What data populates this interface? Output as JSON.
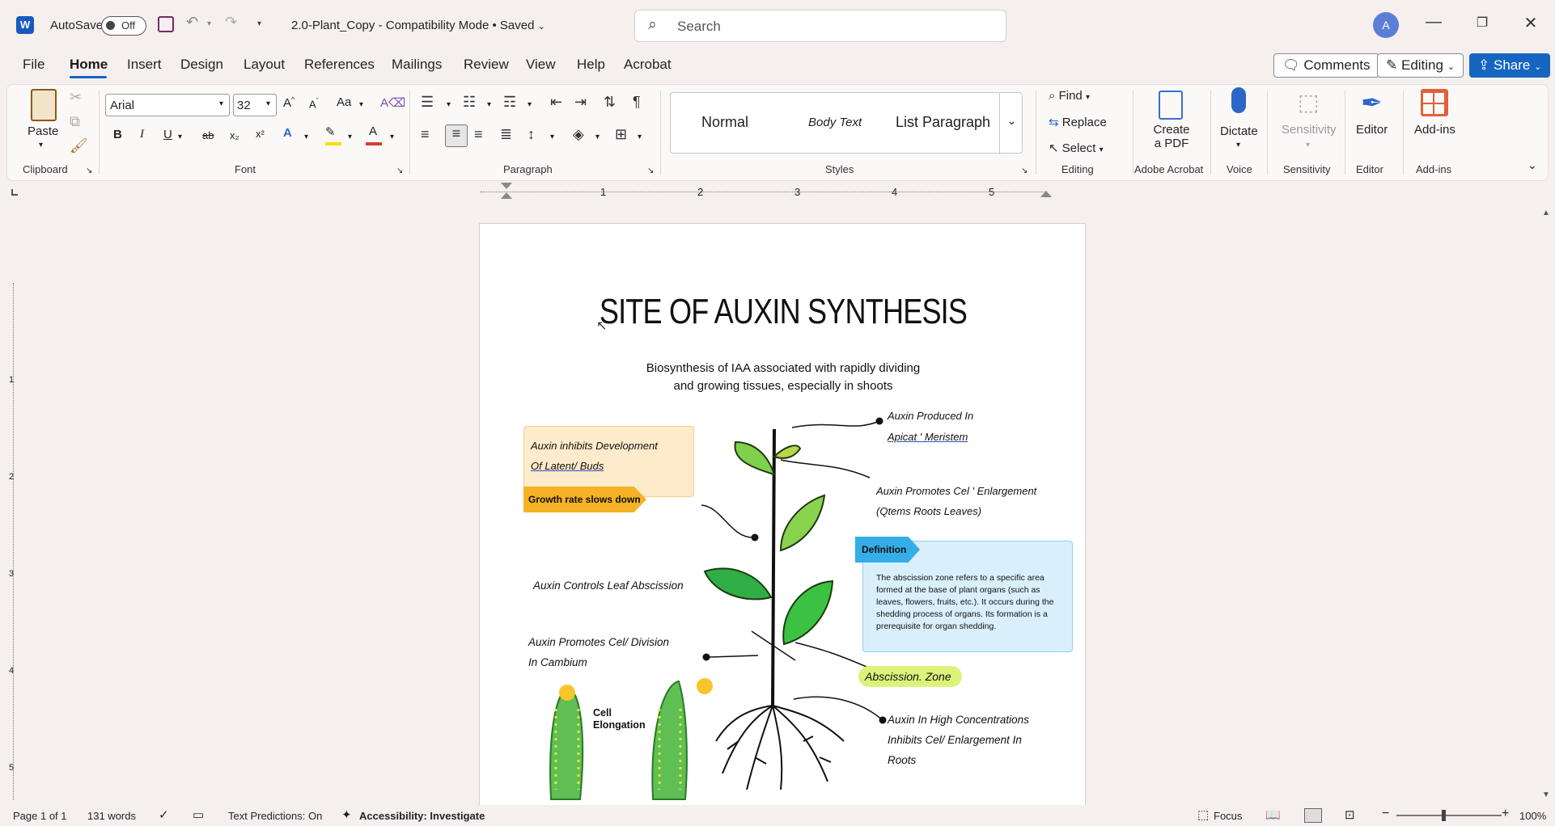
{
  "titlebar": {
    "autosave_label": "AutoSave",
    "autosave_state": "Off",
    "doc_name": "2.0-Plant_Copy",
    "doc_mode": "Compatibility Mode",
    "doc_status": "Saved",
    "search_placeholder": "Search",
    "avatar_initial": "A"
  },
  "menu": {
    "items": [
      "File",
      "Home",
      "Insert",
      "Design",
      "Layout",
      "References",
      "Mailings",
      "Review",
      "View",
      "Help",
      "Acrobat"
    ],
    "active": "Home",
    "comments_label": "Comments",
    "editing_label": "Editing",
    "share_label": "Share"
  },
  "ribbon": {
    "paste_label": "Paste",
    "font_name": "Arial",
    "font_size": "32",
    "case_label": "Aa",
    "bold": "B",
    "italic": "I",
    "underline": "U",
    "strike": "ab",
    "subscript": "x₂",
    "superscript": "x²",
    "styles": [
      "Normal",
      "Body Text",
      "List Paragraph"
    ],
    "find_label": "Find",
    "replace_label": "Replace",
    "select_label": "Select",
    "create_pdf_label_1": "Create",
    "create_pdf_label_2": "a PDF",
    "dictate_label": "Dictate",
    "sensitivity_label": "Sensitivity",
    "editor_label": "Editor",
    "addins_label": "Add-ins",
    "groups": {
      "clipboard": "Clipboard",
      "font": "Font",
      "paragraph": "Paragraph",
      "styles": "Styles",
      "editing": "Editing",
      "adobe": "Adobe Acrobat",
      "voice": "Voice",
      "sensitivity": "Sensitivity",
      "editor": "Editor",
      "addins": "Add-ins"
    },
    "accent_color": "#1665c0"
  },
  "ruler": {
    "numbers": [
      "1",
      "2",
      "3",
      "4",
      "5"
    ],
    "vnumbers": [
      "1",
      "2",
      "3",
      "4",
      "5"
    ]
  },
  "document": {
    "title": "SITE OF AUXIN SYNTHESIS",
    "subtitle_line1": "Biosynthesis of IAA associated with rapidly dividing",
    "subtitle_line2": "and growing tissues, especially in shoots",
    "dev_box_line1": "Auxin inhibits Development",
    "dev_box_line2": "Of Latent/ Buds",
    "growth_banner": "Growth rate slows down",
    "produced_line1": "Auxin Produced In",
    "produced_line2": "Apicat ' Meristem",
    "enlargement_line1": "Auxin Promotes Cel ' Enlargement",
    "enlargement_line2": "(Qtems Roots Leaves)",
    "definition_banner": "Definition",
    "definition_text": "The abscission zone refers to a specific area formed at the base of plant organs (such as leaves, flowers, fruits, etc.). It occurs during the shedding process of organs. Its formation is a prerequisite for organ shedding.",
    "leaf_abscission": "Auxin Controls Leaf Abscission",
    "division_line1": "Auxin  Promotes  Cel/  Division",
    "division_line2": "In  Cambium",
    "abscission_zone": "Abscission. Zone",
    "cell_elongation_1": "Cell",
    "cell_elongation_2": "Elongation",
    "high_conc_line1": "Auxin In High Concentrations",
    "high_conc_line2": "Inhibits Cel/ Enlargement In",
    "high_conc_line3": "Roots"
  },
  "statusbar": {
    "page": "Page 1 of 1",
    "words": "131 words",
    "text_predictions": "Text Predictions: On",
    "accessibility": "Accessibility: Investigate",
    "focus": "Focus",
    "zoom": "100%"
  }
}
